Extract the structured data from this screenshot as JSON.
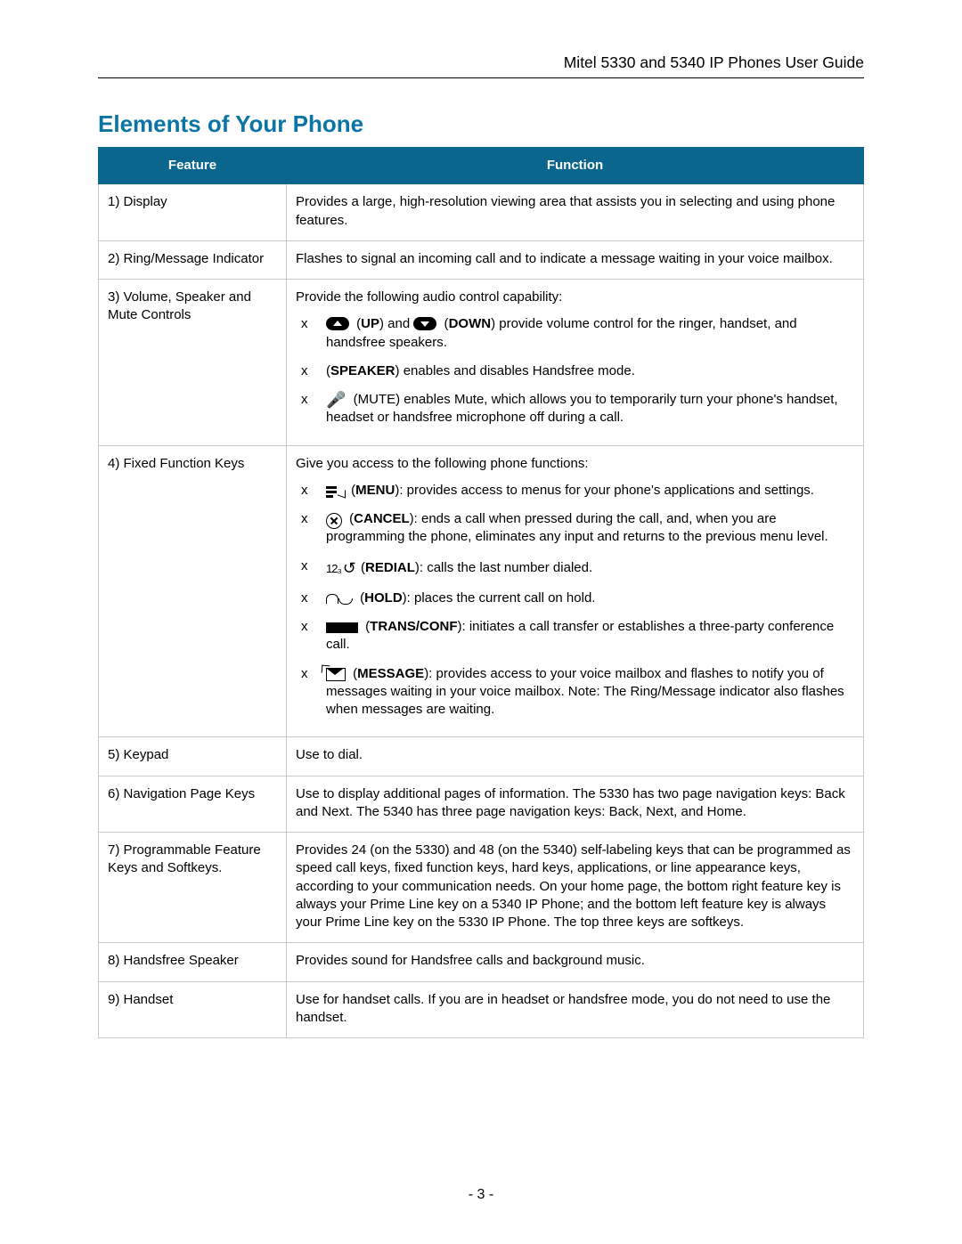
{
  "doc_header": "Mitel 5330 and 5340 IP Phones User Guide",
  "section_title": "Elements of Your Phone",
  "table": {
    "head": {
      "feature": "Feature",
      "function": "Function"
    },
    "rows": {
      "r1": {
        "feature": "1) Display",
        "function": "Provides a large, high-resolution viewing area that assists you in selecting and using phone features."
      },
      "r2": {
        "feature": "2) Ring/Message Indicator",
        "function": "Flashes to signal an incoming call and to indicate a message waiting in your voice mailbox."
      },
      "r3": {
        "feature": "3) Volume, Speaker and Mute Controls",
        "intro": "Provide the following audio control capability:",
        "i1_pre": "(",
        "i1_up": "UP",
        "i1_mid": ") and",
        "i1_dn": "DOWN",
        "i1_post": ") provide volume control for the ringer, handset, and handsfree speakers.",
        "i2_lbl": "SPEAKER",
        "i2_post": ") enables and disables Handsfree mode.",
        "i3": "(MUTE) enables Mute, which allows you to temporarily turn your phone's handset, headset or handsfree microphone off during a call."
      },
      "r4": {
        "feature": "4) Fixed Function Keys",
        "intro": "Give you access to the following phone functions:",
        "i1_lbl": "MENU",
        "i1_post": "): provides access to menus for your phone's applications and settings.",
        "i2_lbl": "CANCEL",
        "i2_post": "): ends a call when pressed during the call, and, when you are programming the phone, eliminates any input and returns to the previous menu level.",
        "i3_lbl": "REDIAL",
        "i3_post": "): calls the last number dialed.",
        "i4_lbl": "HOLD",
        "i4_post": "): places the current call on hold.",
        "i5_lbl": "TRANS/CONF",
        "i5_post": "): initiates a call transfer or establishes a three-party conference call.",
        "i6_lbl": "MESSAGE",
        "i6_post": "): provides access to your voice mailbox and flashes to notify you of messages waiting in your voice mailbox. Note: The Ring/Message indicator also flashes when messages are waiting."
      },
      "r5": {
        "feature": "5) Keypad",
        "function": "Use to dial."
      },
      "r6": {
        "feature": "6) Navigation Page Keys",
        "function": "Use to display additional pages of information. The 5330 has two page navigation keys: Back and Next. The 5340 has three page navigation keys: Back, Next, and Home."
      },
      "r7": {
        "feature": "7) Programmable Feature Keys and Softkeys.",
        "function": "Provides 24 (on the 5330) and 48 (on the 5340) self-labeling keys that can be programmed as speed call keys, fixed function keys, hard keys, applications, or line appearance keys, according to your communication needs. On your home page, the bottom right feature key is always your Prime Line key on a 5340 IP Phone; and the bottom left feature key is always your Prime Line key on the 5330 IP Phone. The top three keys are softkeys."
      },
      "r8": {
        "feature": "8) Handsfree Speaker",
        "function": "Provides sound for Handsfree calls and background music."
      },
      "r9": {
        "feature": "9) Handset",
        "function": "Use for handset calls. If you are in headset or handsfree mode, you do not need to use the handset."
      }
    }
  },
  "page_number": "- 3 -"
}
